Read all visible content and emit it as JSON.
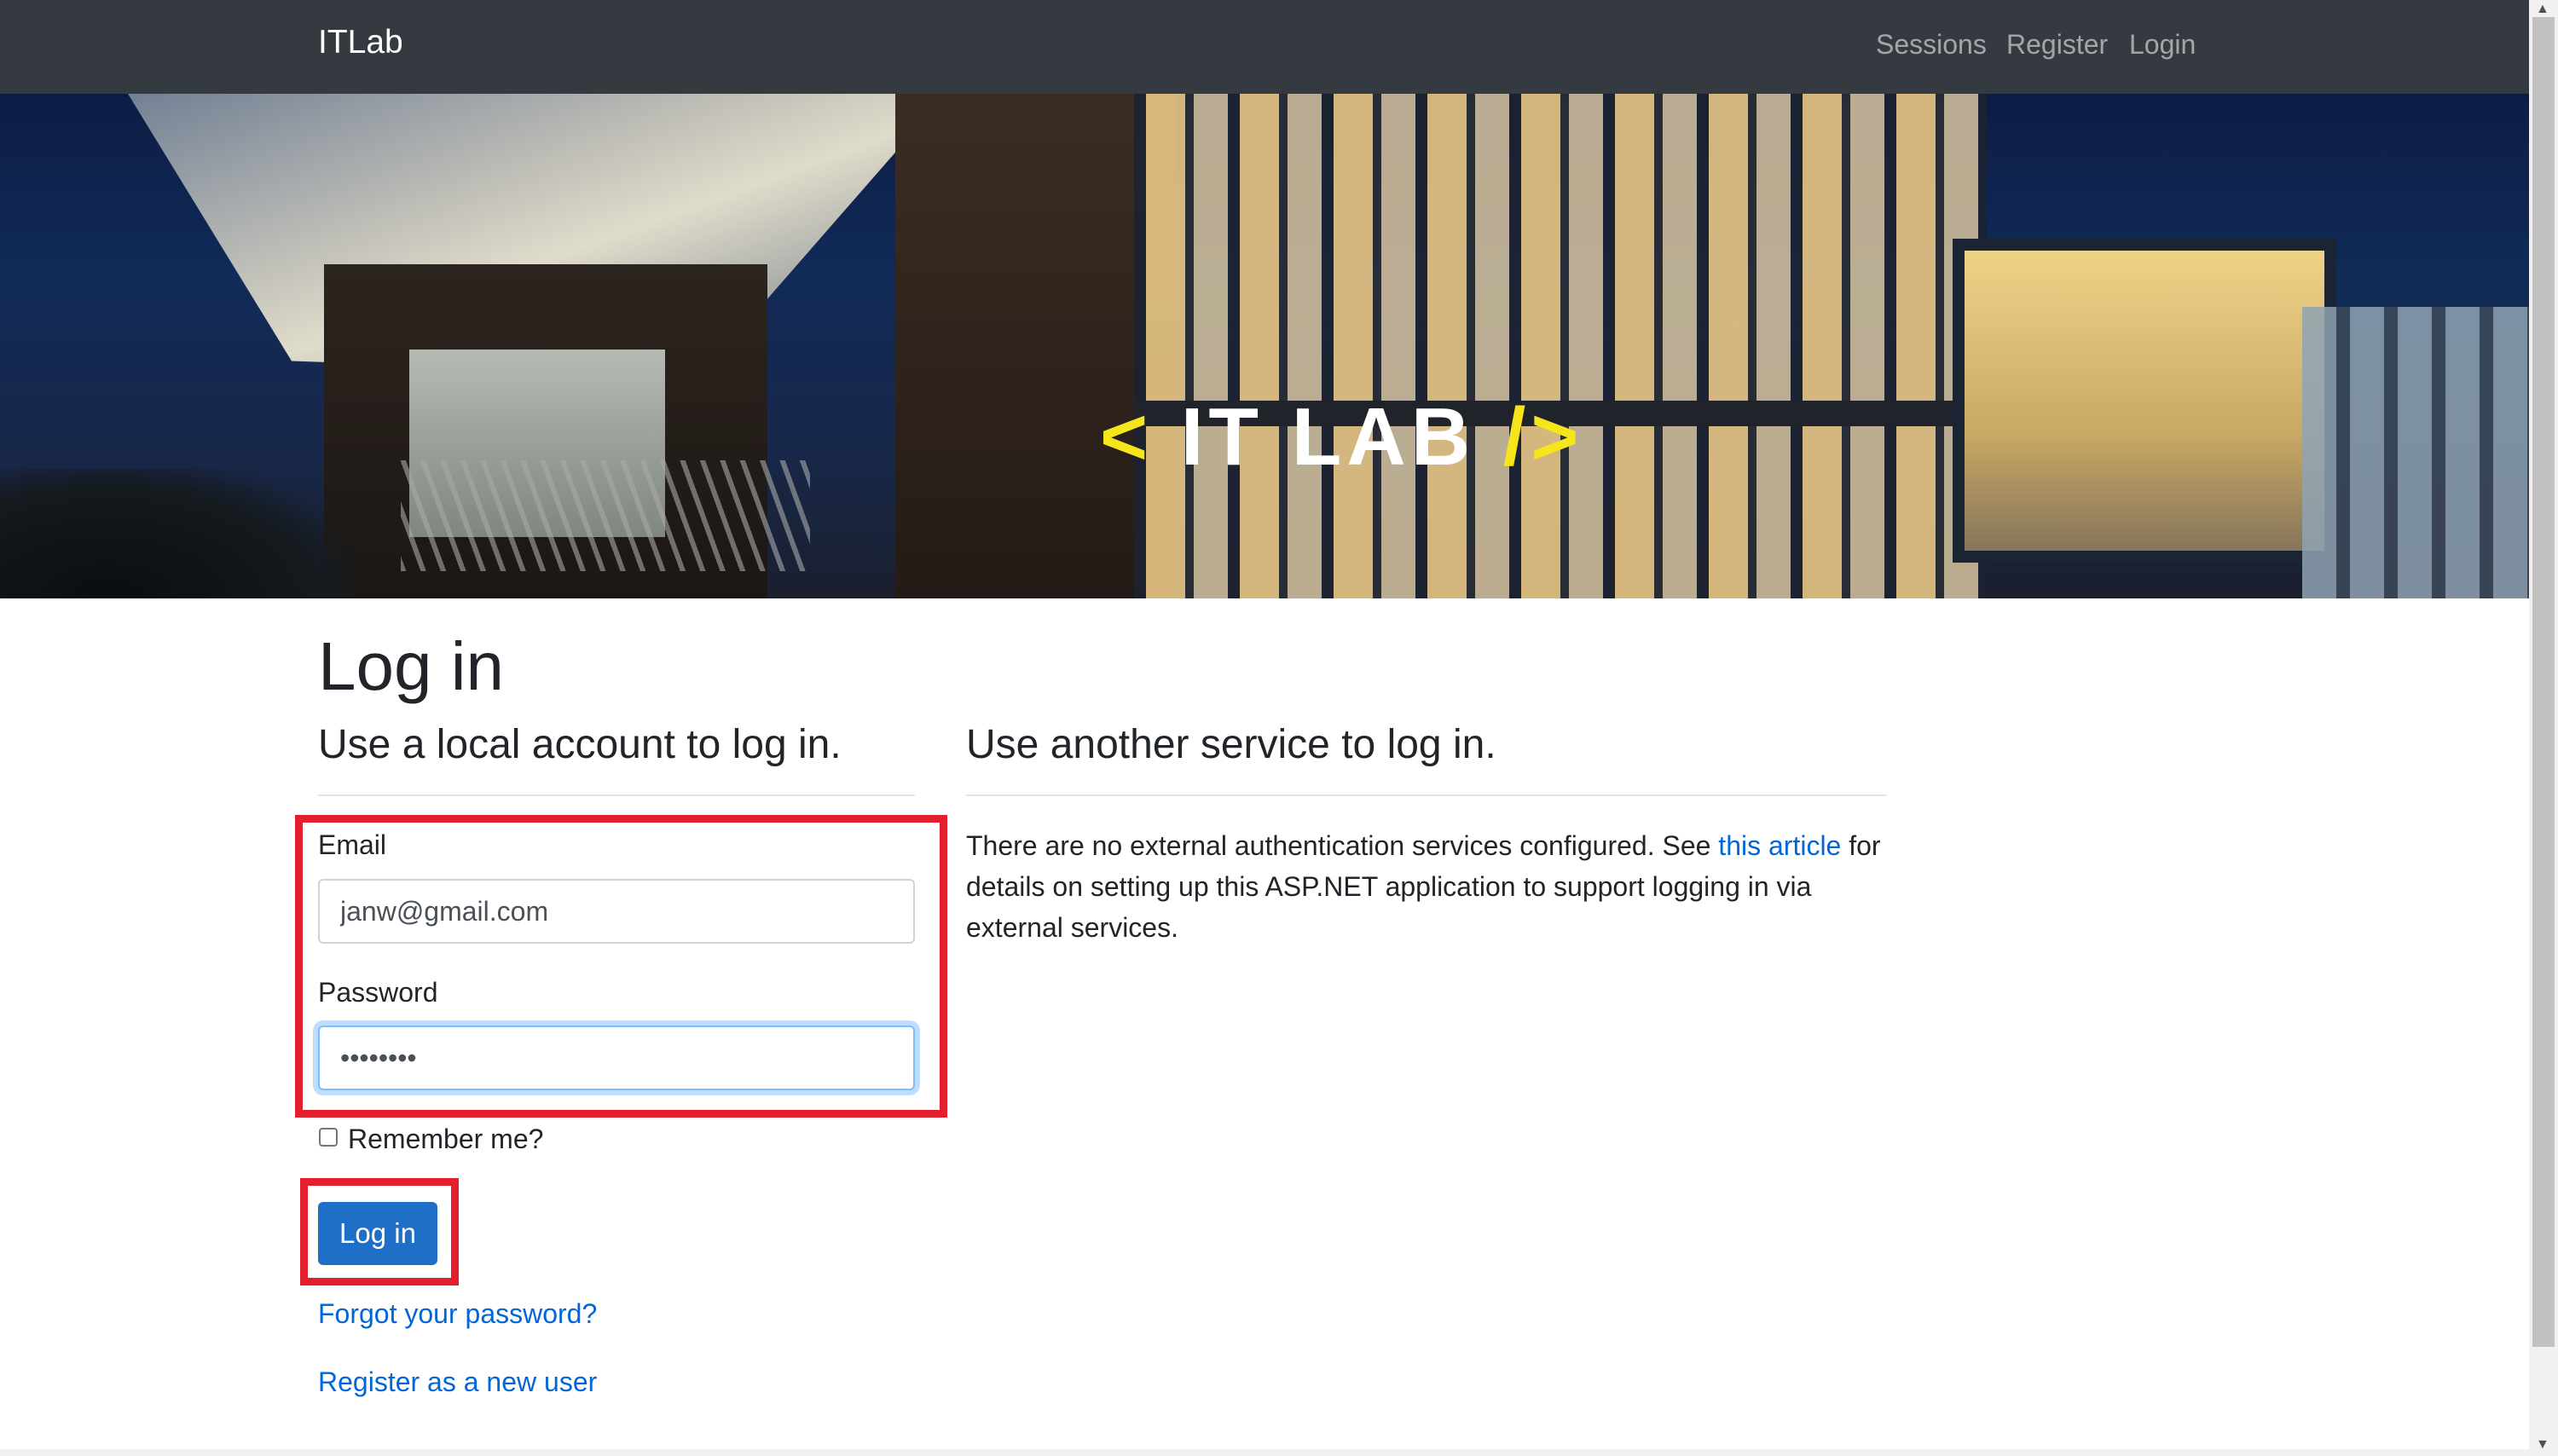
{
  "nav": {
    "brand": "ITLab",
    "links": [
      "Sessions",
      "Register",
      "Login"
    ]
  },
  "hero": {
    "logo_open": "<",
    "logo_text": "IT LAB",
    "logo_close": "/>"
  },
  "page": {
    "title": "Log in",
    "local_heading": "Use a local account to log in.",
    "external_heading": "Use another service to log in."
  },
  "form": {
    "email_label": "Email",
    "email_value": "janw@gmail.com",
    "password_label": "Password",
    "password_value": "••••••••",
    "remember_label": "Remember me?",
    "submit_label": "Log in",
    "forgot_link": "Forgot your password?",
    "register_link": "Register as a new user"
  },
  "external": {
    "text_before": "There are no external authentication services configured. See ",
    "link_text": "this article",
    "text_after": " for details on setting up this ASP.NET application to support logging in via external services."
  },
  "colors": {
    "navbar": "#343a40",
    "primary": "#1e6fc8",
    "link": "#0366d6",
    "highlight": "#e31e2d",
    "logo_accent": "#f5e61c"
  }
}
